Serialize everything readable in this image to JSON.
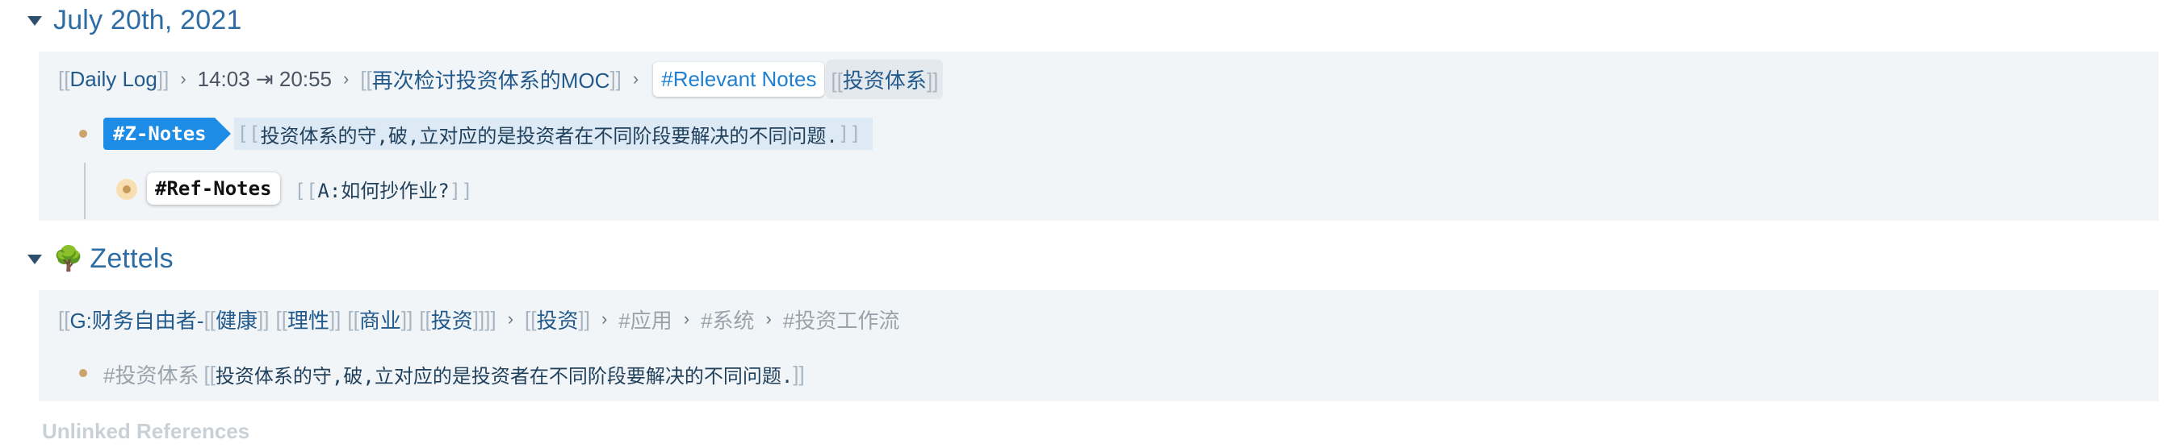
{
  "section1": {
    "title": "July 20th, 2021",
    "breadcrumb": {
      "daily_log": "Daily Log",
      "time_range": "14:03 ⇥ 20:55",
      "moc": "再次检讨投资体系的MOC",
      "relevant_tag": "#Relevant Notes",
      "ref": "投资体系"
    },
    "block1": {
      "tag": "#Z-Notes",
      "ref_text": "投资体系的守,破,立对应的是投资者在不同阶段要解决的不同问题."
    },
    "block2": {
      "tag": "#Ref-Notes",
      "ref_text": "A:如何抄作业?"
    }
  },
  "section2": {
    "title": "Zettels",
    "icon": "tree-icon",
    "breadcrumb": {
      "g_prefix": "G:财务自由者-",
      "health": "健康",
      "rational": "理性",
      "business": "商业",
      "invest": "投资",
      "invest2": "投资",
      "tag_apply": "#应用",
      "tag_system": "#系统",
      "tag_workflow": "#投资工作流"
    },
    "block1": {
      "tag": "#投资体系",
      "ref_text": "投资体系的守,破,立对应的是投资者在不同阶段要解决的不同问题."
    }
  },
  "unlinked": "Unlinked References",
  "colors": {
    "accent": "#2e6da4",
    "tag_blue": "#1c8ce6",
    "panel_bg": "#f2f5f8",
    "bullet": "#c9a56b"
  }
}
